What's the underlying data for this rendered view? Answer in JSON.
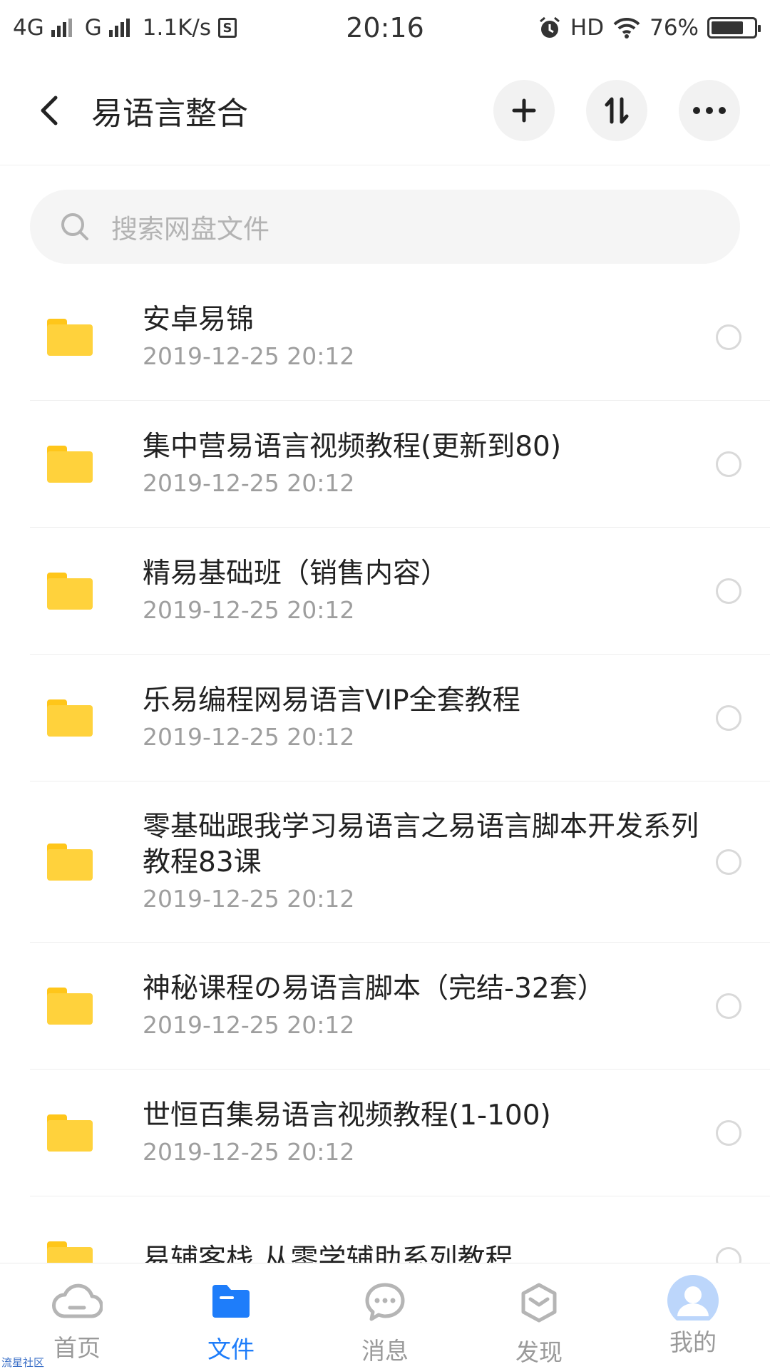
{
  "status_bar": {
    "network_1": "4G",
    "network_2": "G",
    "speed": "1.1K/s",
    "time": "20:16",
    "hd": "HD",
    "battery": "76%",
    "battery_level": 0.76
  },
  "header": {
    "title": "易语言整合",
    "icons": [
      "back-icon",
      "plus-icon",
      "sort-icon",
      "more-icon"
    ]
  },
  "search": {
    "placeholder": "搜索网盘文件"
  },
  "files": [
    {
      "name": "安卓易锦",
      "date": "2019-12-25  20:12"
    },
    {
      "name": "集中营易语言视频教程(更新到80)",
      "date": "2019-12-25  20:12"
    },
    {
      "name": "精易基础班（销售内容）",
      "date": "2019-12-25  20:12"
    },
    {
      "name": "乐易编程网易语言VIP全套教程",
      "date": "2019-12-25  20:12"
    },
    {
      "name": "零基础跟我学习易语言之易语言脚本开发系列教程83课",
      "date": "2019-12-25  20:12"
    },
    {
      "name": "神秘课程の易语言脚本（完结-32套）",
      "date": "2019-12-25  20:12"
    },
    {
      "name": "世恒百集易语言视频教程(1-100)",
      "date": "2019-12-25  20:12"
    },
    {
      "name": "易辅客栈 从零学辅助系列教程",
      "date": ""
    }
  ],
  "tabs": [
    {
      "label": "首页",
      "icon": "cloud-icon",
      "active": false
    },
    {
      "label": "文件",
      "icon": "folder-icon",
      "active": true
    },
    {
      "label": "消息",
      "icon": "chat-icon",
      "active": false
    },
    {
      "label": "发现",
      "icon": "hexagon-icon",
      "active": false
    },
    {
      "label": "我的",
      "icon": "avatar-icon",
      "active": false
    }
  ],
  "watermark": "流星社区",
  "colors": {
    "accent": "#1e7dfa",
    "folder": "#ffd23c",
    "inactive": "#9a9a9a"
  }
}
